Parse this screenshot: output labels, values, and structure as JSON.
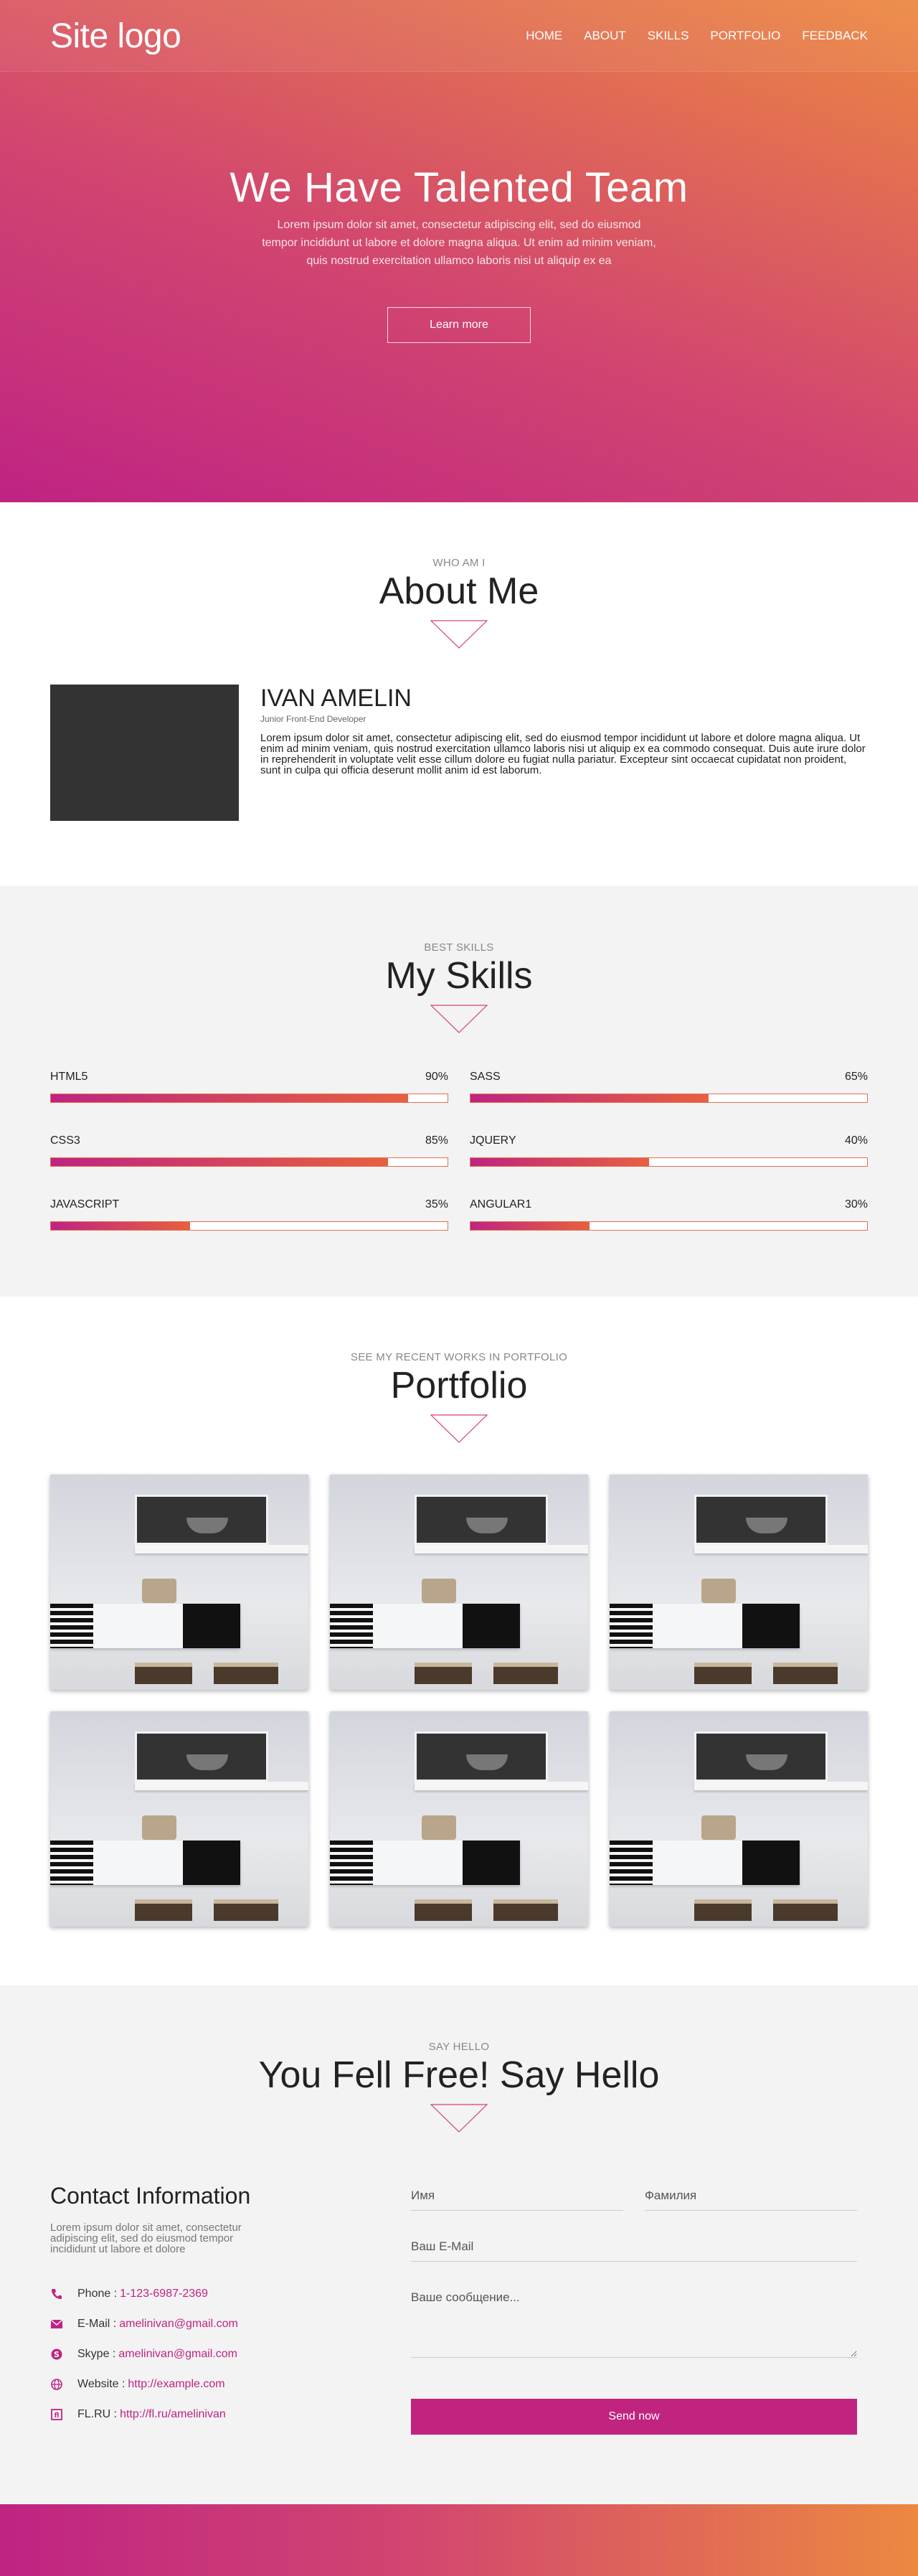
{
  "header": {
    "logo": "Site logo",
    "nav": [
      "HOME",
      "ABOUT",
      "SKILLS",
      "PORTFOLIO",
      "FEEDBACK"
    ]
  },
  "hero": {
    "title": "We Have Talented Team",
    "text": "Lorem ipsum dolor sit amet, consectetur adipiscing elit, sed do eiusmod tempor incididunt ut labore et dolore magna aliqua. Ut enim ad minim veniam, quis nostrud exercitation ullamco laboris nisi ut aliquip ex ea",
    "button": "Learn more"
  },
  "about": {
    "subtitle": "WHO AM I",
    "title": "About Me",
    "name": "IVAN AMELIN",
    "role": "Junior Front-End Developer",
    "description": "Lorem ipsum dolor sit amet, consectetur adipiscing elit, sed do eiusmod tempor incididunt ut labore et dolore magna aliqua. Ut enim ad minim veniam, quis nostrud exercitation ullamco laboris nisi ut aliquip ex ea commodo consequat. Duis aute irure dolor in reprehenderit in voluptate velit esse cillum dolore eu fugiat nulla pariatur. Excepteur sint occaecat cupidatat non proident, sunt in culpa qui officia deserunt mollit anim id est laborum."
  },
  "skills": {
    "subtitle": "BEST SKILLS",
    "title": "My Skills",
    "items": [
      {
        "name": "HTML5",
        "label": "90%",
        "value": 0.9
      },
      {
        "name": "SASS",
        "label": "65%",
        "value": 0.6
      },
      {
        "name": "CSS3",
        "label": "85%",
        "value": 0.85
      },
      {
        "name": "JQUERY",
        "label": "40%",
        "value": 0.45
      },
      {
        "name": "JAVASCRIPT",
        "label": "35%",
        "value": 0.35
      },
      {
        "name": "ANGULAR1",
        "label": "30%",
        "value": 0.3
      }
    ]
  },
  "portfolio": {
    "subtitle": "SEE MY RECENT WORKS IN PORTFOLIO",
    "title": "Portfolio",
    "items": [
      1,
      2,
      3,
      4,
      5,
      6
    ]
  },
  "contact": {
    "subtitle": "SAY HELLO",
    "title": "You Fell Free! Say Hello",
    "info_title": "Contact Information",
    "info_desc": "Lorem ipsum dolor sit amet, consectetur adipiscing elit, sed do eiusmod tempor incididunt ut labore et dolore",
    "items": [
      {
        "icon": "phone-icon",
        "label": "Phone :",
        "value": "1-123-6987-2369"
      },
      {
        "icon": "mail-icon",
        "label": "E-Mail :",
        "value": "amelinivan@gmail.com"
      },
      {
        "icon": "skype-icon",
        "label": "Skype :",
        "value": "amelinivan@gmail.com"
      },
      {
        "icon": "globe-icon",
        "label": "Website :",
        "value": "http://example.com"
      },
      {
        "icon": "fl-icon",
        "label": "FL.RU :",
        "value": "http://fl.ru/amelinivan"
      }
    ],
    "form": {
      "first_name_placeholder": "Имя",
      "last_name_placeholder": "Фамилия",
      "email_placeholder": "Ваш E-Mail",
      "message_placeholder": "Ваше сообщение...",
      "send_label": "Send now"
    }
  },
  "colors": {
    "accent": "#c0247e",
    "gradient_start": "#bf2383",
    "gradient_end": "#ec8840"
  }
}
